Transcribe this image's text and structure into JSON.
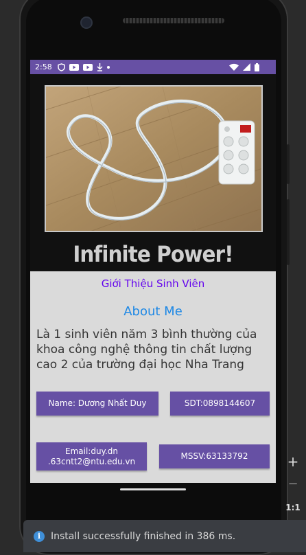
{
  "status_bar": {
    "time": "2:58",
    "left_icons": [
      "vpn-shield-icon",
      "youtube-icon",
      "youtube-icon",
      "download-icon",
      "dot-icon"
    ],
    "right_icons": [
      "wifi-icon",
      "signal-icon",
      "battery-icon"
    ],
    "color": "#6750a4"
  },
  "hero": {
    "caption": "Infinite Power!",
    "image": "power-strip-photo"
  },
  "content": {
    "heading": "Giới Thiệu Sinh Viên",
    "about_title": "About Me",
    "description": "Là 1 sinh viên năm 3 bình thường của khoa công nghệ thông tin chất lượng cao 2 của trường đại học Nha Trang",
    "buttons": {
      "name": "Name: Dương Nhất Duy",
      "phone": "SDT:0898144607",
      "email": "Email:duy.dn .63cntt2@ntu.edu.vn",
      "student_id": "MSSV:63133792"
    },
    "button_color": "#6650a4",
    "heading_color": "#6200ee",
    "about_color": "#1e88e5"
  },
  "emulator": {
    "zoom_in": "+",
    "zoom_out": "−",
    "zoom_reset": "1:1"
  },
  "toast": {
    "message": "Install successfully finished in 386 ms.",
    "icon": "info-icon"
  }
}
